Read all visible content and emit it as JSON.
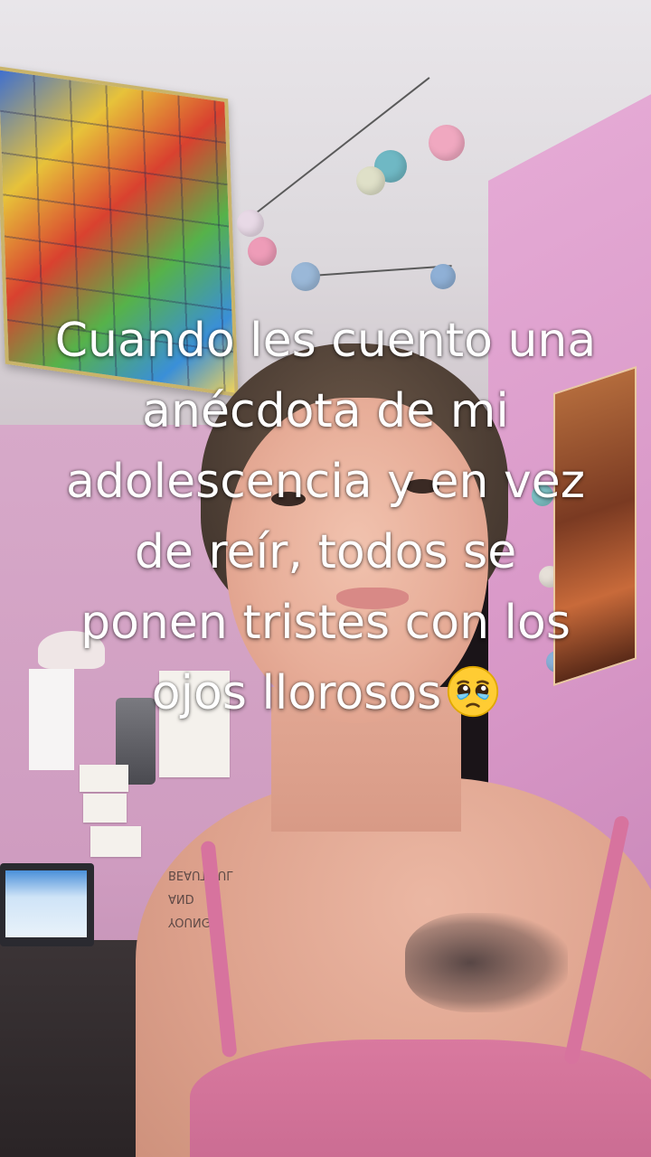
{
  "video": {
    "caption": "Cuando les cuento una anécdota de mi adolescencia y en vez de reír, todos se ponen tristes con los ojos llorosos",
    "caption_emoji": "pleading-face-with-tears-icon",
    "arm_tattoo_text": "YOUNG AND BEAUTIFUL"
  },
  "colors": {
    "caption_text": "#ffffff",
    "wall": "#d7a9c9",
    "garment": "#d9799f"
  }
}
